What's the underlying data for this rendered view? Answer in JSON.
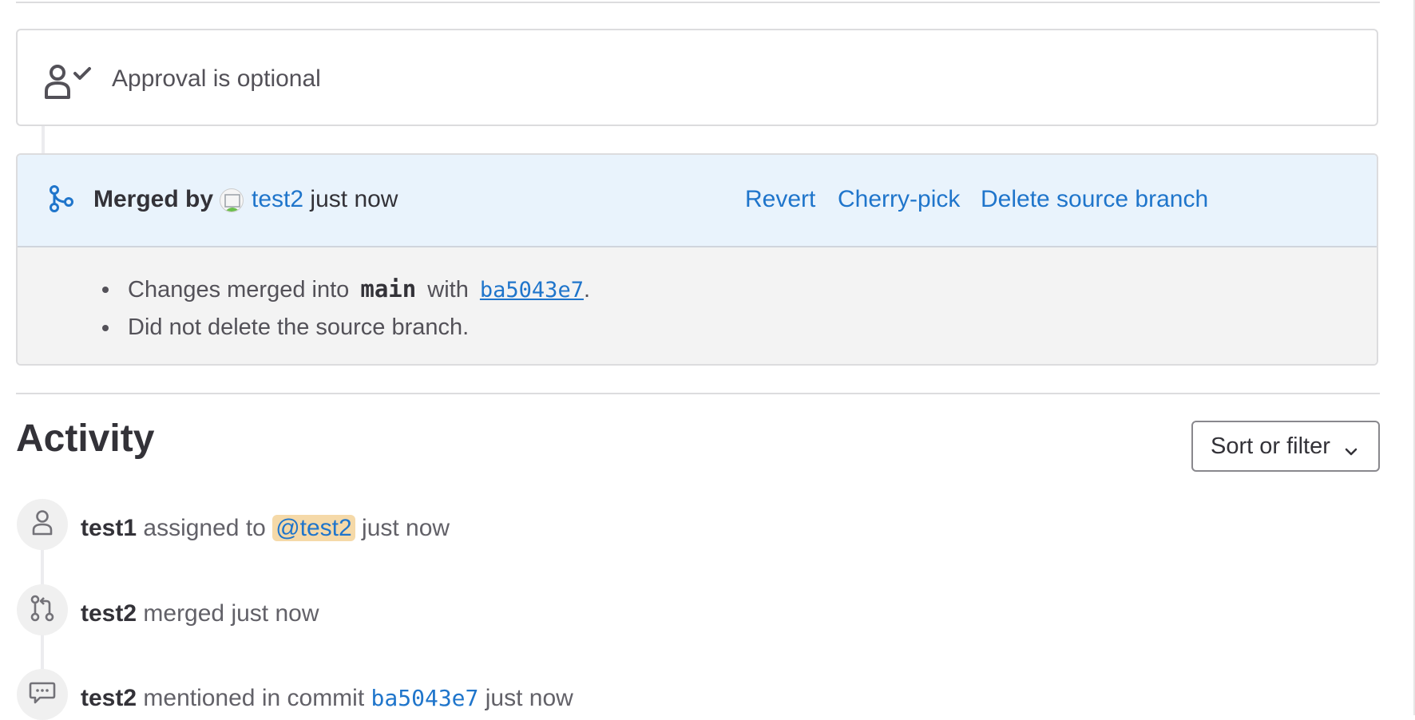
{
  "approval": {
    "text": "Approval is optional"
  },
  "merge_widget": {
    "prefix": "Merged by",
    "user": "test2",
    "time": "just now",
    "actions": {
      "revert": "Revert",
      "cherry_pick": "Cherry-pick",
      "delete_branch": "Delete source branch"
    },
    "details": {
      "line1_prefix": "Changes merged into",
      "branch": "main",
      "line1_mid": "with",
      "commit": "ba5043e7",
      "line1_suffix": ".",
      "line2": "Did not delete the source branch."
    }
  },
  "activity": {
    "title": "Activity",
    "sort_button": "Sort or filter",
    "items": [
      {
        "icon": "user-icon",
        "actor": "test1",
        "action": "assigned to",
        "mention": "@test2",
        "time": "just now"
      },
      {
        "icon": "merge-request-icon",
        "actor": "test2",
        "action": "merged",
        "time": "just now"
      },
      {
        "icon": "comment-icon",
        "actor": "test2",
        "action": "mentioned in commit",
        "commit": "ba5043e7",
        "time": "just now"
      }
    ]
  },
  "colors": {
    "link": "#1f75cb",
    "merged_header_bg": "#e9f3fc",
    "merged_body_bg": "#f3f3f3",
    "mention_bg": "#f5d9a8"
  }
}
